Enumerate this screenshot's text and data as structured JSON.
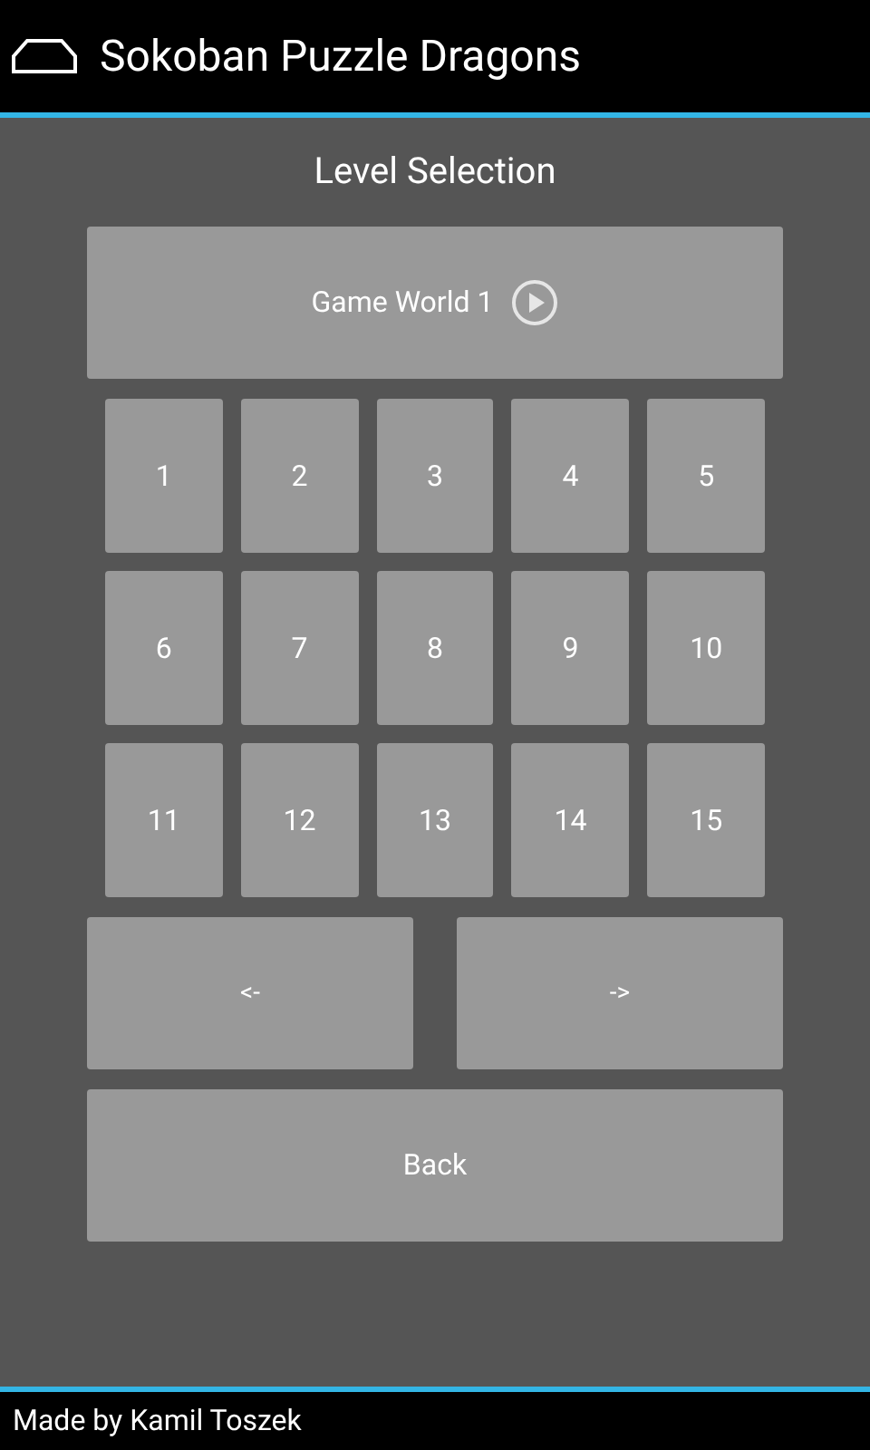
{
  "action_bar": {
    "title": "Sokoban Puzzle Dragons"
  },
  "heading": "Level Selection",
  "world_button": {
    "label": "Game World 1"
  },
  "levels": [
    "1",
    "2",
    "3",
    "4",
    "5",
    "6",
    "7",
    "8",
    "9",
    "10",
    "11",
    "12",
    "13",
    "14",
    "15"
  ],
  "nav_buttons": [
    {
      "label": "<-"
    },
    {
      "label": "->"
    }
  ],
  "back_button": {
    "label": "Back"
  },
  "footer": "Made by Kamil Toszek"
}
